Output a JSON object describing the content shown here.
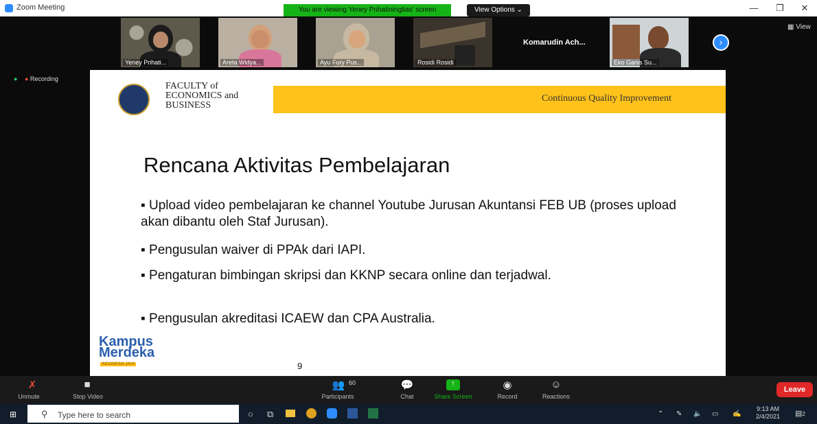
{
  "window": {
    "title": "Zoom Meeting"
  },
  "banner": {
    "text": "You are viewing Yeney Prihatiningtias' screen"
  },
  "view_options": {
    "label": "View Options ⌄"
  },
  "participants_strip": [
    {
      "name": "Yeney Prihati..."
    },
    {
      "name": "Areta Widya..."
    },
    {
      "name": "Ayu Fury Pus..."
    },
    {
      "name": "Rosidi Rosidi"
    },
    {
      "name": "Komarudin Ach..."
    },
    {
      "name": "Eko Ganis Su..."
    }
  ],
  "view_label": "View",
  "recording_label": "Recording",
  "slide": {
    "header_left": [
      "FACULTY of",
      "ECONOMICS and",
      "BUSINESS"
    ],
    "header_right": "Continuous Quality Improvement",
    "title": "Rencana Aktivitas Pembelajaran",
    "bullets": [
      "Upload video pembelajaran ke channel Youtube Jurusan Akuntansi FEB UB (proses upload akan dibantu oleh Staf Jurusan).",
      "Pengusulan waiver di PPAk dari IAPI.",
      "Pengaturan bimbingan skripsi dan KKNP secara online dan terjadwal.",
      "Pengusulan akreditasi ICAEW dan CPA Australia."
    ],
    "page_number": "9",
    "kampus_logo": [
      "Kampus",
      "Merdeka"
    ],
    "kampus_sub": "INDONESIA JAYA"
  },
  "toolbar": {
    "unmute": "Unmute",
    "stop_video": "Stop Video",
    "participants": "Participants",
    "participants_count": "60",
    "chat": "Chat",
    "share_screen": "Share Screen",
    "record": "Record",
    "reactions": "Reactions",
    "leave": "Leave"
  },
  "taskbar": {
    "search_placeholder": "Type here to search",
    "time": "9:13 AM",
    "date": "2/4/2021",
    "notification_count": "2"
  },
  "colors": {
    "accent": "#2d8cff",
    "banner": "#16b316",
    "leave": "#e02828",
    "slide_band": "#ffc21a"
  }
}
